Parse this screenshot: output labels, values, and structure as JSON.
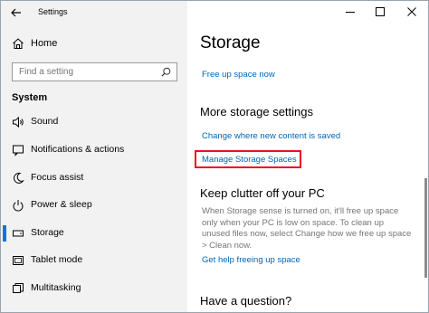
{
  "window": {
    "title": "Settings",
    "controls": {
      "minimize": "minimize",
      "maximize": "maximize",
      "close": "close"
    }
  },
  "sidebar": {
    "home_label": "Home",
    "search_placeholder": "Find a setting",
    "section_label": "System",
    "items": [
      {
        "label": "Sound",
        "icon": "speaker-icon"
      },
      {
        "label": "Notifications & actions",
        "icon": "notifications-icon"
      },
      {
        "label": "Focus assist",
        "icon": "moon-icon"
      },
      {
        "label": "Power & sleep",
        "icon": "power-icon"
      },
      {
        "label": "Storage",
        "icon": "storage-icon",
        "selected": true
      },
      {
        "label": "Tablet mode",
        "icon": "tablet-icon"
      },
      {
        "label": "Multitasking",
        "icon": "multitasking-icon"
      }
    ]
  },
  "main": {
    "title": "Storage",
    "free_up_link": "Free up space now",
    "more_settings_heading": "More storage settings",
    "change_location_link": "Change where new content is saved",
    "manage_spaces_link": "Manage Storage Spaces",
    "clutter_heading": "Keep clutter off your PC",
    "clutter_text": "When Storage sense is turned on, it'll free up space only when your PC is low on space. To clean up unused files now, select Change how we free up space > Clean now.",
    "help_link": "Get help freeing up space",
    "question_heading": "Have a question?"
  },
  "colors": {
    "accent": "#0078d7",
    "link": "#0066b4",
    "highlight": "#e81123",
    "sidebar_bg": "#f2f2f2"
  }
}
